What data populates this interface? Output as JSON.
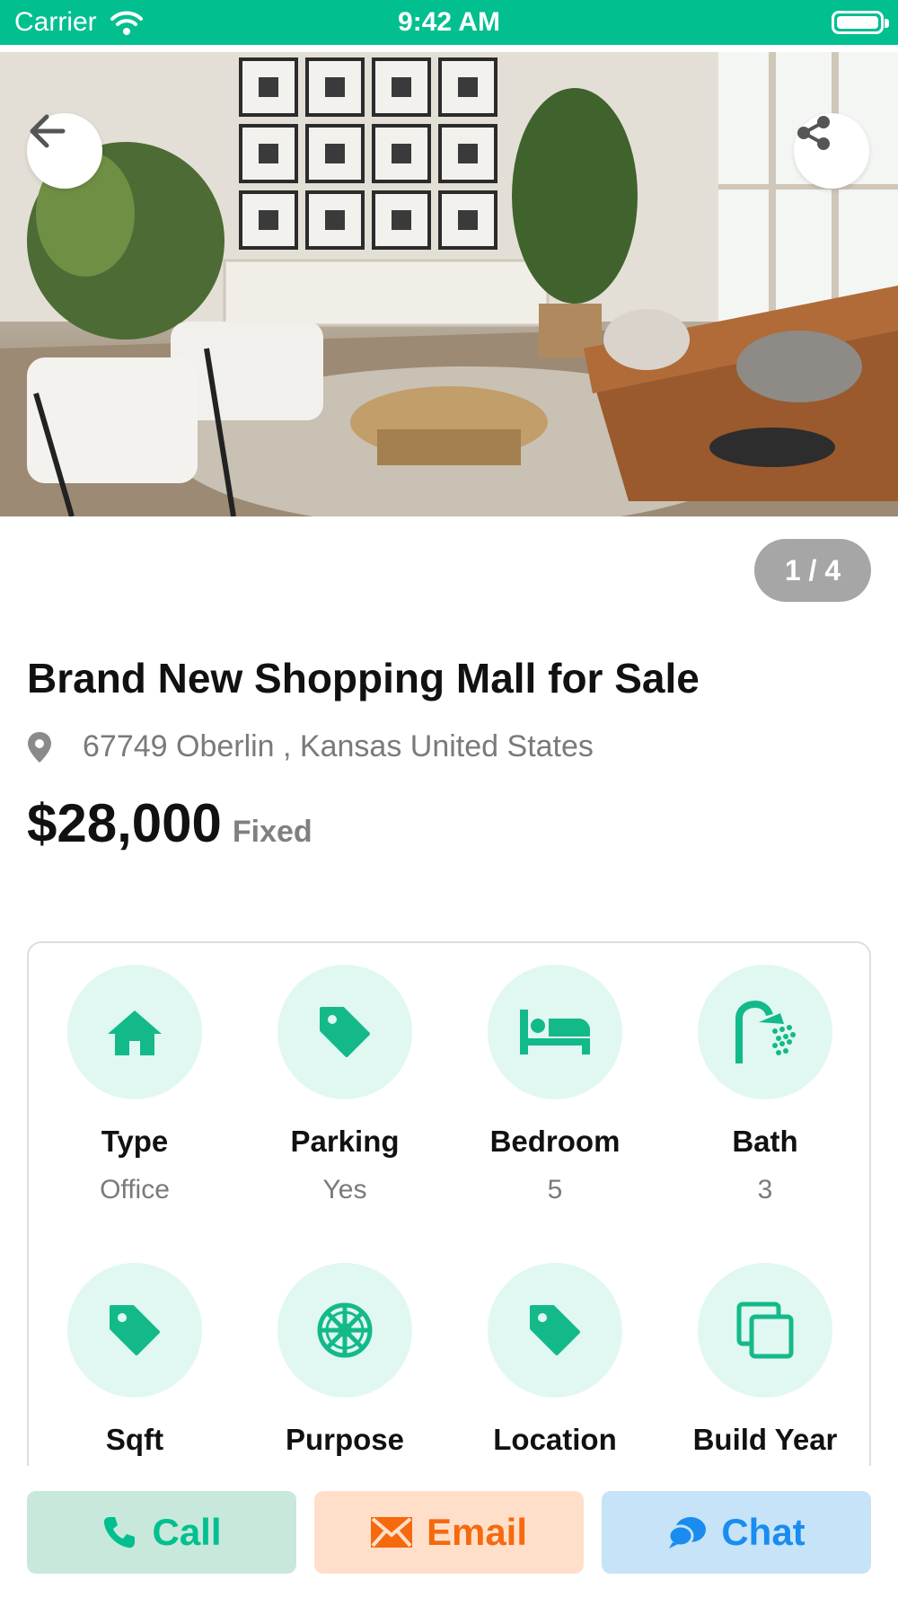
{
  "status_bar": {
    "carrier": "Carrier",
    "time": "9:42 AM"
  },
  "gallery": {
    "counter": "1 / 4"
  },
  "listing": {
    "title": "Brand New Shopping Mall for Sale",
    "address": "67749 Oberlin , Kansas United States",
    "price": "$28,000",
    "price_type": "Fixed"
  },
  "features": [
    {
      "label": "Type",
      "value": "Office",
      "icon": "home-icon"
    },
    {
      "label": "Parking",
      "value": "Yes",
      "icon": "tag-icon"
    },
    {
      "label": "Bedroom",
      "value": "5",
      "icon": "bed-icon"
    },
    {
      "label": "Bath",
      "value": "3",
      "icon": "shower-icon"
    },
    {
      "label": "Sqft",
      "value": "",
      "icon": "tag-icon"
    },
    {
      "label": "Purpose",
      "value": "",
      "icon": "galactic-empire-icon"
    },
    {
      "label": "Location",
      "value": "",
      "icon": "tag-icon"
    },
    {
      "label": "Build Year",
      "value": "",
      "icon": "copy-icon"
    }
  ],
  "actions": {
    "call": "Call",
    "email": "Email",
    "chat": "Chat"
  },
  "colors": {
    "accent": "#02bf8f",
    "call_bg": "#c8e8dc",
    "email": "#f56a0f",
    "email_bg": "#ffdfca",
    "chat": "#1a8cf0",
    "chat_bg": "#c6e3f7",
    "icon_circle": "#e0f8f1"
  }
}
